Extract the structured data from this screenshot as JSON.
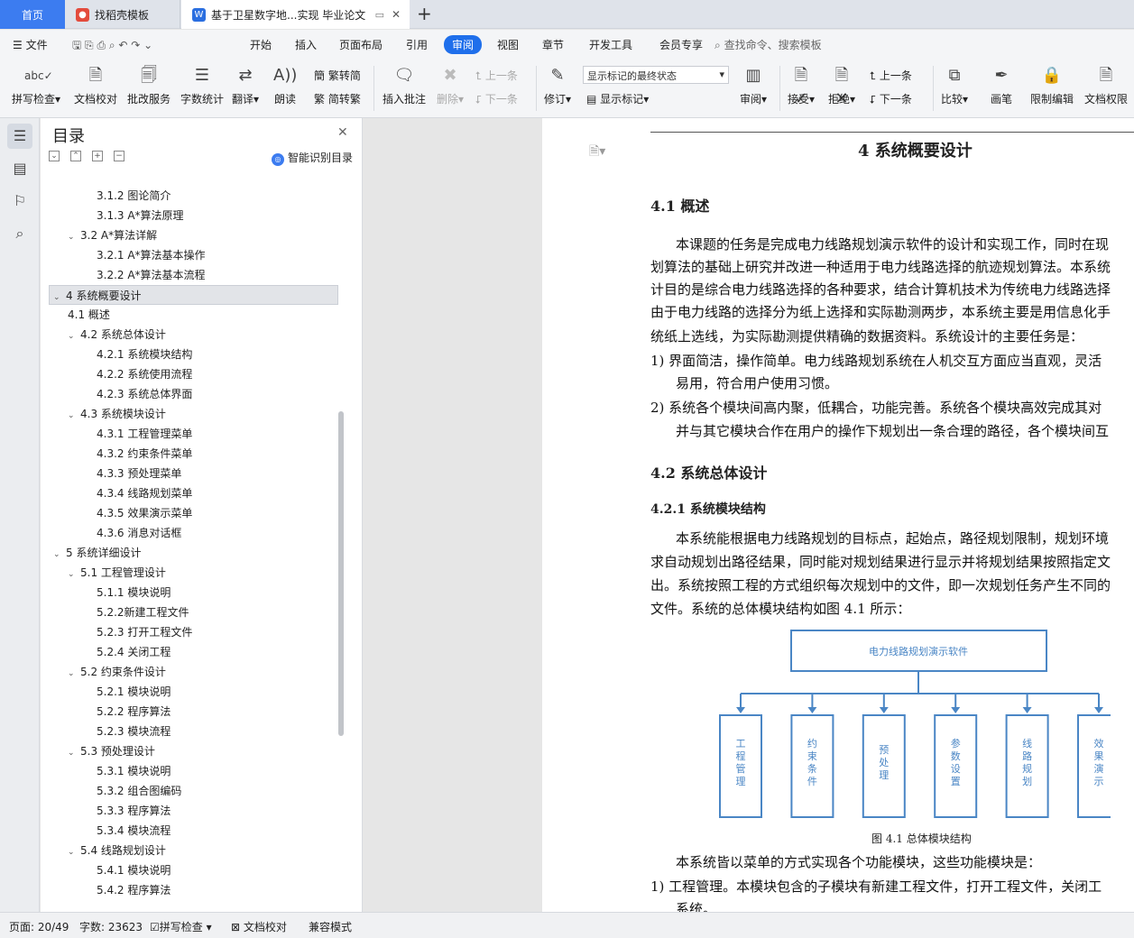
{
  "tabs": {
    "home": "首页",
    "tab2": "找稻壳模板",
    "tab3": "基于卫星数字地...实现 毕业论文"
  },
  "menu": [
    "文件",
    "开始",
    "插入",
    "页面布局",
    "引用",
    "审阅",
    "视图",
    "章节",
    "开发工具",
    "会员专享"
  ],
  "search": "查找命令、搜索模板",
  "ribbon": {
    "spell": "拼写检查",
    "proof": "文档校对",
    "batch": "批改服务",
    "count": "字数统计",
    "translate": "翻译",
    "read": "朗读",
    "trad": "繁转简",
    "simp": "简转繁",
    "comment": "插入批注",
    "del": "删除",
    "prev": "上一条",
    "next": "下一条",
    "revise": "修订",
    "markup_mode": "显示标记的最终状态",
    "show_markup": "显示标记",
    "review": "审阅",
    "accept": "接受",
    "reject": "拒绝",
    "prev2": "上一条",
    "next2": "下一条",
    "compare": "比较",
    "pen": "画笔",
    "restrict": "限制编辑",
    "perm": "文档权限"
  },
  "nav": {
    "title": "目录",
    "smart": "智能识别目录",
    "items": [
      {
        "t": "3.1.2  图论简介",
        "l": 3
      },
      {
        "t": "3.1.3 A*算法原理",
        "l": 3
      },
      {
        "t": "3.2 A*算法详解",
        "l": 2,
        "a": 1
      },
      {
        "t": "3.2.1 A*算法基本操作",
        "l": 3
      },
      {
        "t": "3.2.2 A*算法基本流程",
        "l": 3
      },
      {
        "t": "4  系统概要设计",
        "l": 1,
        "a": 1,
        "s": 1
      },
      {
        "t": "4.1  概述",
        "l": 2
      },
      {
        "t": "4.2  系统总体设计",
        "l": 2,
        "a": 1
      },
      {
        "t": "4.2.1  系统模块结构",
        "l": 3
      },
      {
        "t": "4.2.2  系统使用流程",
        "l": 3
      },
      {
        "t": "4.2.3  系统总体界面",
        "l": 3
      },
      {
        "t": "4.3  系统模块设计",
        "l": 2,
        "a": 1
      },
      {
        "t": "4.3.1  工程管理菜单",
        "l": 3
      },
      {
        "t": "4.3.2  约束条件菜单",
        "l": 3
      },
      {
        "t": "4.3.3  预处理菜单",
        "l": 3
      },
      {
        "t": "4.3.4  线路规划菜单",
        "l": 3
      },
      {
        "t": "4.3.5  效果演示菜单",
        "l": 3
      },
      {
        "t": "4.3.6  消息对话框",
        "l": 3
      },
      {
        "t": "5  系统详细设计",
        "l": 1,
        "a": 1
      },
      {
        "t": "5.1  工程管理设计",
        "l": 2,
        "a": 1
      },
      {
        "t": "5.1.1  模块说明",
        "l": 3
      },
      {
        "t": "5.2.2新建工程文件",
        "l": 3
      },
      {
        "t": "5.2.3  打开工程文件",
        "l": 3
      },
      {
        "t": "5.2.4  关闭工程",
        "l": 3
      },
      {
        "t": "5.2  约束条件设计",
        "l": 2,
        "a": 1
      },
      {
        "t": "5.2.1  模块说明",
        "l": 3
      },
      {
        "t": "5.2.2  程序算法",
        "l": 3
      },
      {
        "t": "5.2.3  模块流程",
        "l": 3
      },
      {
        "t": "5.3  预处理设计",
        "l": 2,
        "a": 1
      },
      {
        "t": "5.3.1  模块说明",
        "l": 3
      },
      {
        "t": "5.3.2  组合图编码",
        "l": 3
      },
      {
        "t": "5.3.3  程序算法",
        "l": 3
      },
      {
        "t": "5.3.4  模块流程",
        "l": 3
      },
      {
        "t": "5.4  线路规划设计",
        "l": 2,
        "a": 1
      },
      {
        "t": "5.4.1  模块说明",
        "l": 3
      },
      {
        "t": "5.4.2  程序算法",
        "l": 3
      }
    ]
  },
  "doc": {
    "h1": "4  系统概要设计",
    "h41": "4.1  概述",
    "p1": [
      "本课题的任务是完成电力线路规划演示软件的设计和实现工作，同时在现",
      "划算法的基础上研究并改进一种适用于电力线路选择的航迹规划算法。本系统",
      "计目的是综合电力线路选择的各种要求，结合计算机技术为传统电力线路选择",
      "由于电力线路的选择分为纸上选择和实际勘测两步，本系统主要是用信息化手",
      "统纸上选线，为实际勘测提供精确的数据资料。系统设计的主要任务是："
    ],
    "l1": "1)   界面简洁，操作简单。电力线路规划系统在人机交互方面应当直观，灵活",
    "l1b": "易用，符合用户使用习惯。",
    "l2": "2)   系统各个模块间高内聚，低耦合，功能完善。系统各个模块高效完成其对",
    "l2b": "并与其它模块合作在用户的操作下规划出一条合理的路径，各个模块间互",
    "h42": "4.2  系统总体设计",
    "h421": "4.2.1  系统模块结构",
    "p2": [
      "本系统能根据电力线路规划的目标点，起始点，路径规划限制，规划环境",
      "求自动规划出路径结果，同时能对规划结果进行显示并将规划结果按照指定文",
      "出。系统按照工程的方式组织每次规划中的文件，即一次规划任务产生不同的",
      "文件。系统的总体模块结构如图 4.1 所示："
    ],
    "diagram": {
      "root": "电力线路规划演示软件",
      "children": [
        "工程管理",
        "约束条件",
        "预处理",
        "参数设置",
        "线路规划",
        "效果演示"
      ]
    },
    "caption": "图 4.1  总体模块结构",
    "p3": "本系统皆以菜单的方式实现各个功能模块，这些功能模块是：",
    "l3": "1)   工程管理。本模块包含的子模块有新建工程文件，打开工程文件，关闭工",
    "l3b": "系统。"
  },
  "status": {
    "page": "页面: 20/49",
    "words": "字数: 23623",
    "spell": "拼写检查",
    "proof": "文档校对",
    "compat": "兼容模式"
  }
}
